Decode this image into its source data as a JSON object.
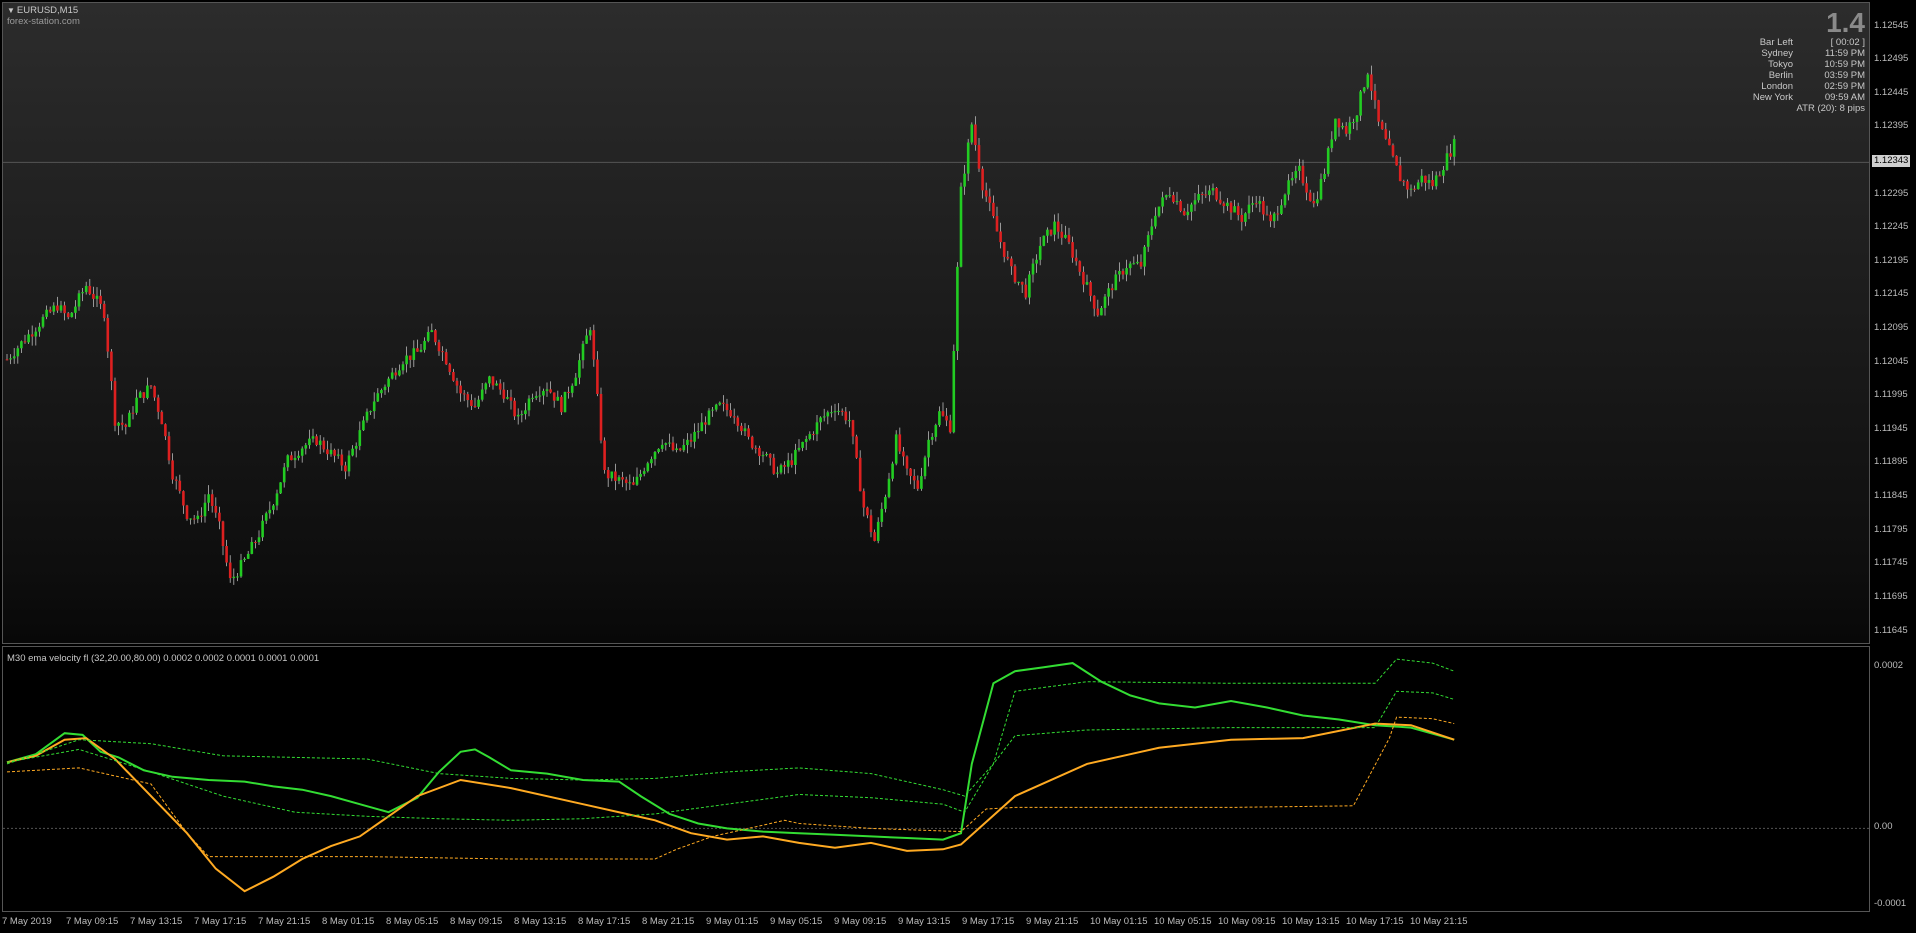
{
  "chart": {
    "symbol_label": "EURUSD,M15",
    "watermark": "forex-station.com",
    "current_price": "1.12343",
    "colors": {
      "bull": "#22cc22",
      "bear": "#dd2020",
      "green_line": "#33dd33",
      "orange_line": "#ffaa22"
    }
  },
  "price_axis": {
    "labels": [
      "1.12545",
      "1.12495",
      "1.12445",
      "1.12395",
      "1.12295",
      "1.12245",
      "1.12195",
      "1.12145",
      "1.12095",
      "1.12045",
      "1.11995",
      "1.11945",
      "1.11895",
      "1.11845",
      "1.11795",
      "1.11745",
      "1.11695",
      "1.11645"
    ],
    "min": 1.11625,
    "max": 1.1258
  },
  "info_panel": {
    "big_value": "1.4",
    "rows": [
      {
        "label": "Bar Left",
        "value": "[ 00:02 ]"
      },
      {
        "label": "Sydney",
        "value": "11:59 PM"
      },
      {
        "label": "Tokyo",
        "value": "10:59 PM"
      },
      {
        "label": "Berlin",
        "value": "03:59 PM"
      },
      {
        "label": "London",
        "value": "02:59 PM"
      },
      {
        "label": "New York",
        "value": "09:59 AM"
      }
    ],
    "atr": "ATR (20): 8 pips"
  },
  "indicator": {
    "title": "M30 ema velocity fl (32,20.00,80.00) 0.0002 0.0002 0.0001 0.0001 0.0001",
    "axis_labels": [
      "0.0002",
      "0.00",
      "-0.0001"
    ],
    "min": -0.000105,
    "max": 0.000225
  },
  "time_axis": {
    "labels": [
      "7 May 2019",
      "7 May 09:15",
      "7 May 13:15",
      "7 May 17:15",
      "7 May 21:15",
      "8 May 01:15",
      "8 May 05:15",
      "8 May 09:15",
      "8 May 13:15",
      "8 May 17:15",
      "8 May 21:15",
      "9 May 01:15",
      "9 May 05:15",
      "9 May 09:15",
      "9 May 13:15",
      "9 May 17:15",
      "9 May 21:15",
      "10 May 01:15",
      "10 May 05:15",
      "10 May 09:15",
      "10 May 13:15",
      "10 May 17:15",
      "10 May 21:15"
    ]
  },
  "chart_data": {
    "type": "candlestick",
    "close_path": [
      [
        0,
        1.1205
      ],
      [
        5,
        1.1208
      ],
      [
        10,
        1.1211
      ],
      [
        14,
        1.1213
      ],
      [
        17,
        1.1211
      ],
      [
        22,
        1.1216
      ],
      [
        27,
        1.1212
      ],
      [
        30,
        1.1196
      ],
      [
        33,
        1.1195
      ],
      [
        36,
        1.1199
      ],
      [
        40,
        1.1201
      ],
      [
        43,
        1.1196
      ],
      [
        46,
        1.1188
      ],
      [
        50,
        1.1182
      ],
      [
        53,
        1.1181
      ],
      [
        56,
        1.1185
      ],
      [
        59,
        1.118
      ],
      [
        62,
        1.1172
      ],
      [
        66,
        1.1175
      ],
      [
        70,
        1.1179
      ],
      [
        74,
        1.1184
      ],
      [
        78,
        1.119
      ],
      [
        82,
        1.1192
      ],
      [
        86,
        1.1193
      ],
      [
        90,
        1.1191
      ],
      [
        94,
        1.1189
      ],
      [
        98,
        1.1194
      ],
      [
        102,
        1.1199
      ],
      [
        106,
        1.1202
      ],
      [
        110,
        1.1205
      ],
      [
        114,
        1.1206
      ],
      [
        118,
        1.1209
      ],
      [
        122,
        1.1205
      ],
      [
        126,
        1.12
      ],
      [
        130,
        1.1198
      ],
      [
        134,
        1.1202
      ],
      [
        138,
        1.12
      ],
      [
        142,
        1.1196
      ],
      [
        146,
        1.12
      ],
      [
        150,
        1.1201
      ],
      [
        154,
        1.1198
      ],
      [
        158,
        1.1203
      ],
      [
        162,
        1.121
      ],
      [
        166,
        1.1188
      ],
      [
        170,
        1.1187
      ],
      [
        174,
        1.1186
      ],
      [
        178,
        1.119
      ],
      [
        182,
        1.1193
      ],
      [
        186,
        1.1191
      ],
      [
        190,
        1.1193
      ],
      [
        194,
        1.1196
      ],
      [
        198,
        1.1198
      ],
      [
        202,
        1.1197
      ],
      [
        206,
        1.1193
      ],
      [
        210,
        1.1191
      ],
      [
        214,
        1.1188
      ],
      [
        218,
        1.119
      ],
      [
        222,
        1.1193
      ],
      [
        226,
        1.1196
      ],
      [
        230,
        1.1198
      ],
      [
        234,
        1.1196
      ],
      [
        238,
        1.1183
      ],
      [
        241,
        1.1178
      ],
      [
        244,
        1.1185
      ],
      [
        247,
        1.1193
      ],
      [
        250,
        1.1188
      ],
      [
        253,
        1.1186
      ],
      [
        256,
        1.1193
      ],
      [
        259,
        1.1197
      ],
      [
        262,
        1.1195
      ],
      [
        265,
        1.123
      ],
      [
        268,
        1.124
      ],
      [
        271,
        1.1231
      ],
      [
        275,
        1.1224
      ],
      [
        279,
        1.1218
      ],
      [
        283,
        1.1215
      ],
      [
        287,
        1.1222
      ],
      [
        291,
        1.1225
      ],
      [
        295,
        1.1222
      ],
      [
        299,
        1.1217
      ],
      [
        303,
        1.1212
      ],
      [
        307,
        1.1216
      ],
      [
        311,
        1.1219
      ],
      [
        315,
        1.1219
      ],
      [
        319,
        1.1227
      ],
      [
        323,
        1.123
      ],
      [
        327,
        1.1227
      ],
      [
        331,
        1.1229
      ],
      [
        335,
        1.123
      ],
      [
        339,
        1.1228
      ],
      [
        343,
        1.1226
      ],
      [
        347,
        1.1229
      ],
      [
        351,
        1.1225
      ],
      [
        355,
        1.123
      ],
      [
        359,
        1.1233
      ],
      [
        363,
        1.1228
      ],
      [
        366,
        1.1233
      ],
      [
        369,
        1.1241
      ],
      [
        372,
        1.1239
      ],
      [
        375,
        1.1242
      ],
      [
        378,
        1.1248
      ],
      [
        381,
        1.124
      ],
      [
        384,
        1.1236
      ],
      [
        387,
        1.1232
      ],
      [
        390,
        1.123
      ],
      [
        393,
        1.1232
      ],
      [
        396,
        1.1231
      ],
      [
        399,
        1.1234
      ],
      [
        402,
        1.1237
      ]
    ],
    "indicator_series": [
      {
        "color": "#33dd33",
        "style": "solid",
        "points": [
          [
            0,
            8.2e-05
          ],
          [
            8,
            9.2e-05
          ],
          [
            16,
            0.000118
          ],
          [
            21,
            0.000116
          ],
          [
            26,
            9.5e-05
          ],
          [
            31,
            8.8e-05
          ],
          [
            38,
            7.2e-05
          ],
          [
            46,
            6.4e-05
          ],
          [
            56,
            6e-05
          ],
          [
            66,
            5.8e-05
          ],
          [
            74,
            5.2e-05
          ],
          [
            82,
            4.8e-05
          ],
          [
            90,
            4e-05
          ],
          [
            98,
            3e-05
          ],
          [
            106,
            2e-05
          ],
          [
            114,
            3.8e-05
          ],
          [
            120,
            7e-05
          ],
          [
            126,
            9.5e-05
          ],
          [
            130,
            9.8e-05
          ],
          [
            134,
            8.8e-05
          ],
          [
            140,
            7.2e-05
          ],
          [
            150,
            6.8e-05
          ],
          [
            160,
            6e-05
          ],
          [
            170,
            5.8e-05
          ],
          [
            176,
            4e-05
          ],
          [
            184,
            1.8e-05
          ],
          [
            192,
            6e-06
          ],
          [
            200,
            0.0
          ],
          [
            210,
            -4e-06
          ],
          [
            220,
            -6e-06
          ],
          [
            230,
            -8e-06
          ],
          [
            240,
            -1e-05
          ],
          [
            250,
            -1.2e-05
          ],
          [
            260,
            -1.4e-05
          ],
          [
            265,
            -6e-06
          ],
          [
            268,
            8e-05
          ],
          [
            274,
            0.00018
          ],
          [
            280,
            0.000195
          ],
          [
            288,
            0.0002
          ],
          [
            296,
            0.000205
          ],
          [
            304,
            0.000182
          ],
          [
            312,
            0.000165
          ],
          [
            320,
            0.000155
          ],
          [
            330,
            0.00015
          ],
          [
            340,
            0.000158
          ],
          [
            350,
            0.00015
          ],
          [
            360,
            0.00014
          ],
          [
            370,
            0.000135
          ],
          [
            380,
            0.000128
          ],
          [
            390,
            0.000125
          ],
          [
            402,
            0.00011
          ]
        ]
      },
      {
        "color": "#ffaa22",
        "style": "solid",
        "points": [
          [
            0,
            8.2e-05
          ],
          [
            8,
            9e-05
          ],
          [
            16,
            0.00011
          ],
          [
            22,
            0.000112
          ],
          [
            30,
            8.6e-05
          ],
          [
            40,
            4e-05
          ],
          [
            50,
            -6e-06
          ],
          [
            58,
            -5e-05
          ],
          [
            66,
            -7.8e-05
          ],
          [
            74,
            -6e-05
          ],
          [
            82,
            -3.8e-05
          ],
          [
            90,
            -2.2e-05
          ],
          [
            98,
            -1e-05
          ],
          [
            106,
            1.5e-05
          ],
          [
            114,
            4e-05
          ],
          [
            126,
            6e-05
          ],
          [
            140,
            5e-05
          ],
          [
            160,
            3e-05
          ],
          [
            180,
            1e-05
          ],
          [
            190,
            -6e-06
          ],
          [
            200,
            -1.4e-05
          ],
          [
            210,
            -1e-05
          ],
          [
            220,
            -1.8e-05
          ],
          [
            230,
            -2.4e-05
          ],
          [
            240,
            -1.8e-05
          ],
          [
            250,
            -2.8e-05
          ],
          [
            260,
            -2.6e-05
          ],
          [
            265,
            -2e-05
          ],
          [
            280,
            4e-05
          ],
          [
            300,
            8e-05
          ],
          [
            320,
            0.0001
          ],
          [
            340,
            0.00011
          ],
          [
            360,
            0.000112
          ],
          [
            380,
            0.00013
          ],
          [
            390,
            0.000128
          ],
          [
            402,
            0.00011
          ]
        ]
      },
      {
        "color": "#33dd33",
        "style": "dashed",
        "points": [
          [
            0,
            8e-05
          ],
          [
            20,
            0.00011
          ],
          [
            40,
            0.000105
          ],
          [
            60,
            9e-05
          ],
          [
            80,
            8.8e-05
          ],
          [
            100,
            8.6e-05
          ],
          [
            120,
            6.8e-05
          ],
          [
            140,
            6.2e-05
          ],
          [
            160,
            6e-05
          ],
          [
            180,
            6.2e-05
          ],
          [
            200,
            7e-05
          ],
          [
            220,
            7.5e-05
          ],
          [
            240,
            6.8e-05
          ],
          [
            260,
            4.8e-05
          ],
          [
            266,
            4e-05
          ],
          [
            274,
            8e-05
          ],
          [
            280,
            0.00017
          ],
          [
            300,
            0.000182
          ],
          [
            340,
            0.00018
          ],
          [
            380,
            0.00018
          ],
          [
            386,
            0.00021
          ],
          [
            396,
            0.000205
          ],
          [
            402,
            0.000195
          ]
        ]
      },
      {
        "color": "#33dd33",
        "style": "dashed",
        "points": [
          [
            0,
            8.2e-05
          ],
          [
            20,
            9.8e-05
          ],
          [
            40,
            7e-05
          ],
          [
            60,
            4e-05
          ],
          [
            80,
            2e-05
          ],
          [
            100,
            1.5e-05
          ],
          [
            120,
            1.2e-05
          ],
          [
            140,
            1e-05
          ],
          [
            160,
            1.2e-05
          ],
          [
            180,
            1.8e-05
          ],
          [
            200,
            3e-05
          ],
          [
            220,
            4.2e-05
          ],
          [
            240,
            3.8e-05
          ],
          [
            260,
            3e-05
          ],
          [
            266,
            2e-05
          ],
          [
            274,
            8e-05
          ],
          [
            280,
            0.000115
          ],
          [
            300,
            0.000122
          ],
          [
            340,
            0.000125
          ],
          [
            380,
            0.000125
          ],
          [
            386,
            0.00017
          ],
          [
            396,
            0.000168
          ],
          [
            402,
            0.00016
          ]
        ]
      },
      {
        "color": "#ffaa22",
        "style": "dashed",
        "points": [
          [
            0,
            7e-05
          ],
          [
            20,
            7.5e-05
          ],
          [
            40,
            5.5e-05
          ],
          [
            50,
            -6e-06
          ],
          [
            56,
            -3.5e-05
          ],
          [
            60,
            -3.5e-05
          ],
          [
            100,
            -3.5e-05
          ],
          [
            140,
            -3.8e-05
          ],
          [
            180,
            -3.8e-05
          ],
          [
            186,
            -2.6e-05
          ],
          [
            196,
            -1e-05
          ],
          [
            206,
            0.0
          ],
          [
            216,
            1e-05
          ],
          [
            220,
            6e-06
          ],
          [
            240,
            0.0
          ],
          [
            265,
            -4e-06
          ],
          [
            272,
            2.4e-05
          ],
          [
            280,
            2.6e-05
          ],
          [
            300,
            2.6e-05
          ],
          [
            340,
            2.6e-05
          ],
          [
            374,
            2.8e-05
          ],
          [
            384,
            0.000112
          ],
          [
            386,
            0.000138
          ],
          [
            396,
            0.000136
          ],
          [
            402,
            0.00013
          ]
        ]
      }
    ]
  }
}
